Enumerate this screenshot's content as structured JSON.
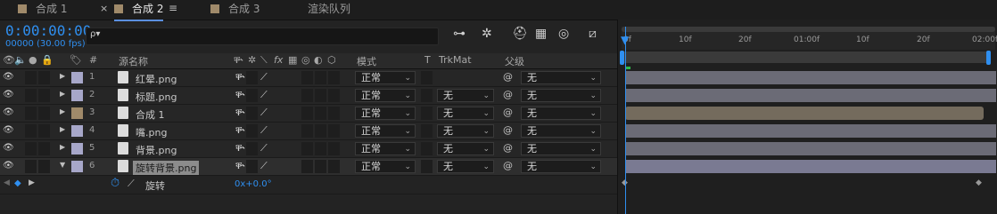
{
  "tabs": [
    {
      "label": "合成 1",
      "color": "#a08a6a",
      "active": false
    },
    {
      "label": "合成 2",
      "color": "#a08a6a",
      "active": true
    },
    {
      "label": "合成 3",
      "color": "#a08a6a",
      "active": false
    },
    {
      "label": "渲染队列",
      "active": false
    }
  ],
  "tab_close": "×",
  "tab_menu": "≡",
  "timecode": "0:00:00:00",
  "fps": "00000 (30.00 fps)",
  "search": {
    "placeholder": "",
    "icon": "ρ▾"
  },
  "header": {
    "source_name": "源名称",
    "mode": "模式",
    "t": "T",
    "trkmat": "TrkMat",
    "parent": "父级",
    "fx": "fx"
  },
  "layers": [
    {
      "num": "1",
      "name": "红晕.png",
      "label_color": "#a7a7c9",
      "mode": "正常",
      "trkmat": "",
      "parent": "无",
      "bar_color": "#6b6b76"
    },
    {
      "num": "2",
      "name": "标题.png",
      "label_color": "#a7a7c9",
      "mode": "正常",
      "trkmat": "无",
      "parent": "无",
      "bar_color": "#6b6b76"
    },
    {
      "num": "3",
      "name": "合成 1",
      "label_color": "#a08a6a",
      "mode": "正常",
      "trkmat": "无",
      "parent": "无",
      "bar_color": "#746b5d"
    },
    {
      "num": "4",
      "name": "嘴.png",
      "label_color": "#a7a7c9",
      "mode": "正常",
      "trkmat": "无",
      "parent": "无",
      "bar_color": "#6b6b76"
    },
    {
      "num": "5",
      "name": "背景.png",
      "label_color": "#a7a7c9",
      "mode": "正常",
      "trkmat": "无",
      "parent": "无",
      "bar_color": "#6b6b76"
    },
    {
      "num": "6",
      "name": "旋转背景.png",
      "label_color": "#a7a7c9",
      "mode": "正常",
      "trkmat": "无",
      "parent": "无",
      "bar_color": "#7a7a92",
      "selected": true
    }
  ],
  "property": {
    "name": "旋转",
    "value": "0x+0.0°"
  },
  "ruler_ticks": [
    "0f",
    "10f",
    "20f",
    "01:00f",
    "10f",
    "20f",
    "02:00f"
  ],
  "accent_color": "#2f8ff0"
}
